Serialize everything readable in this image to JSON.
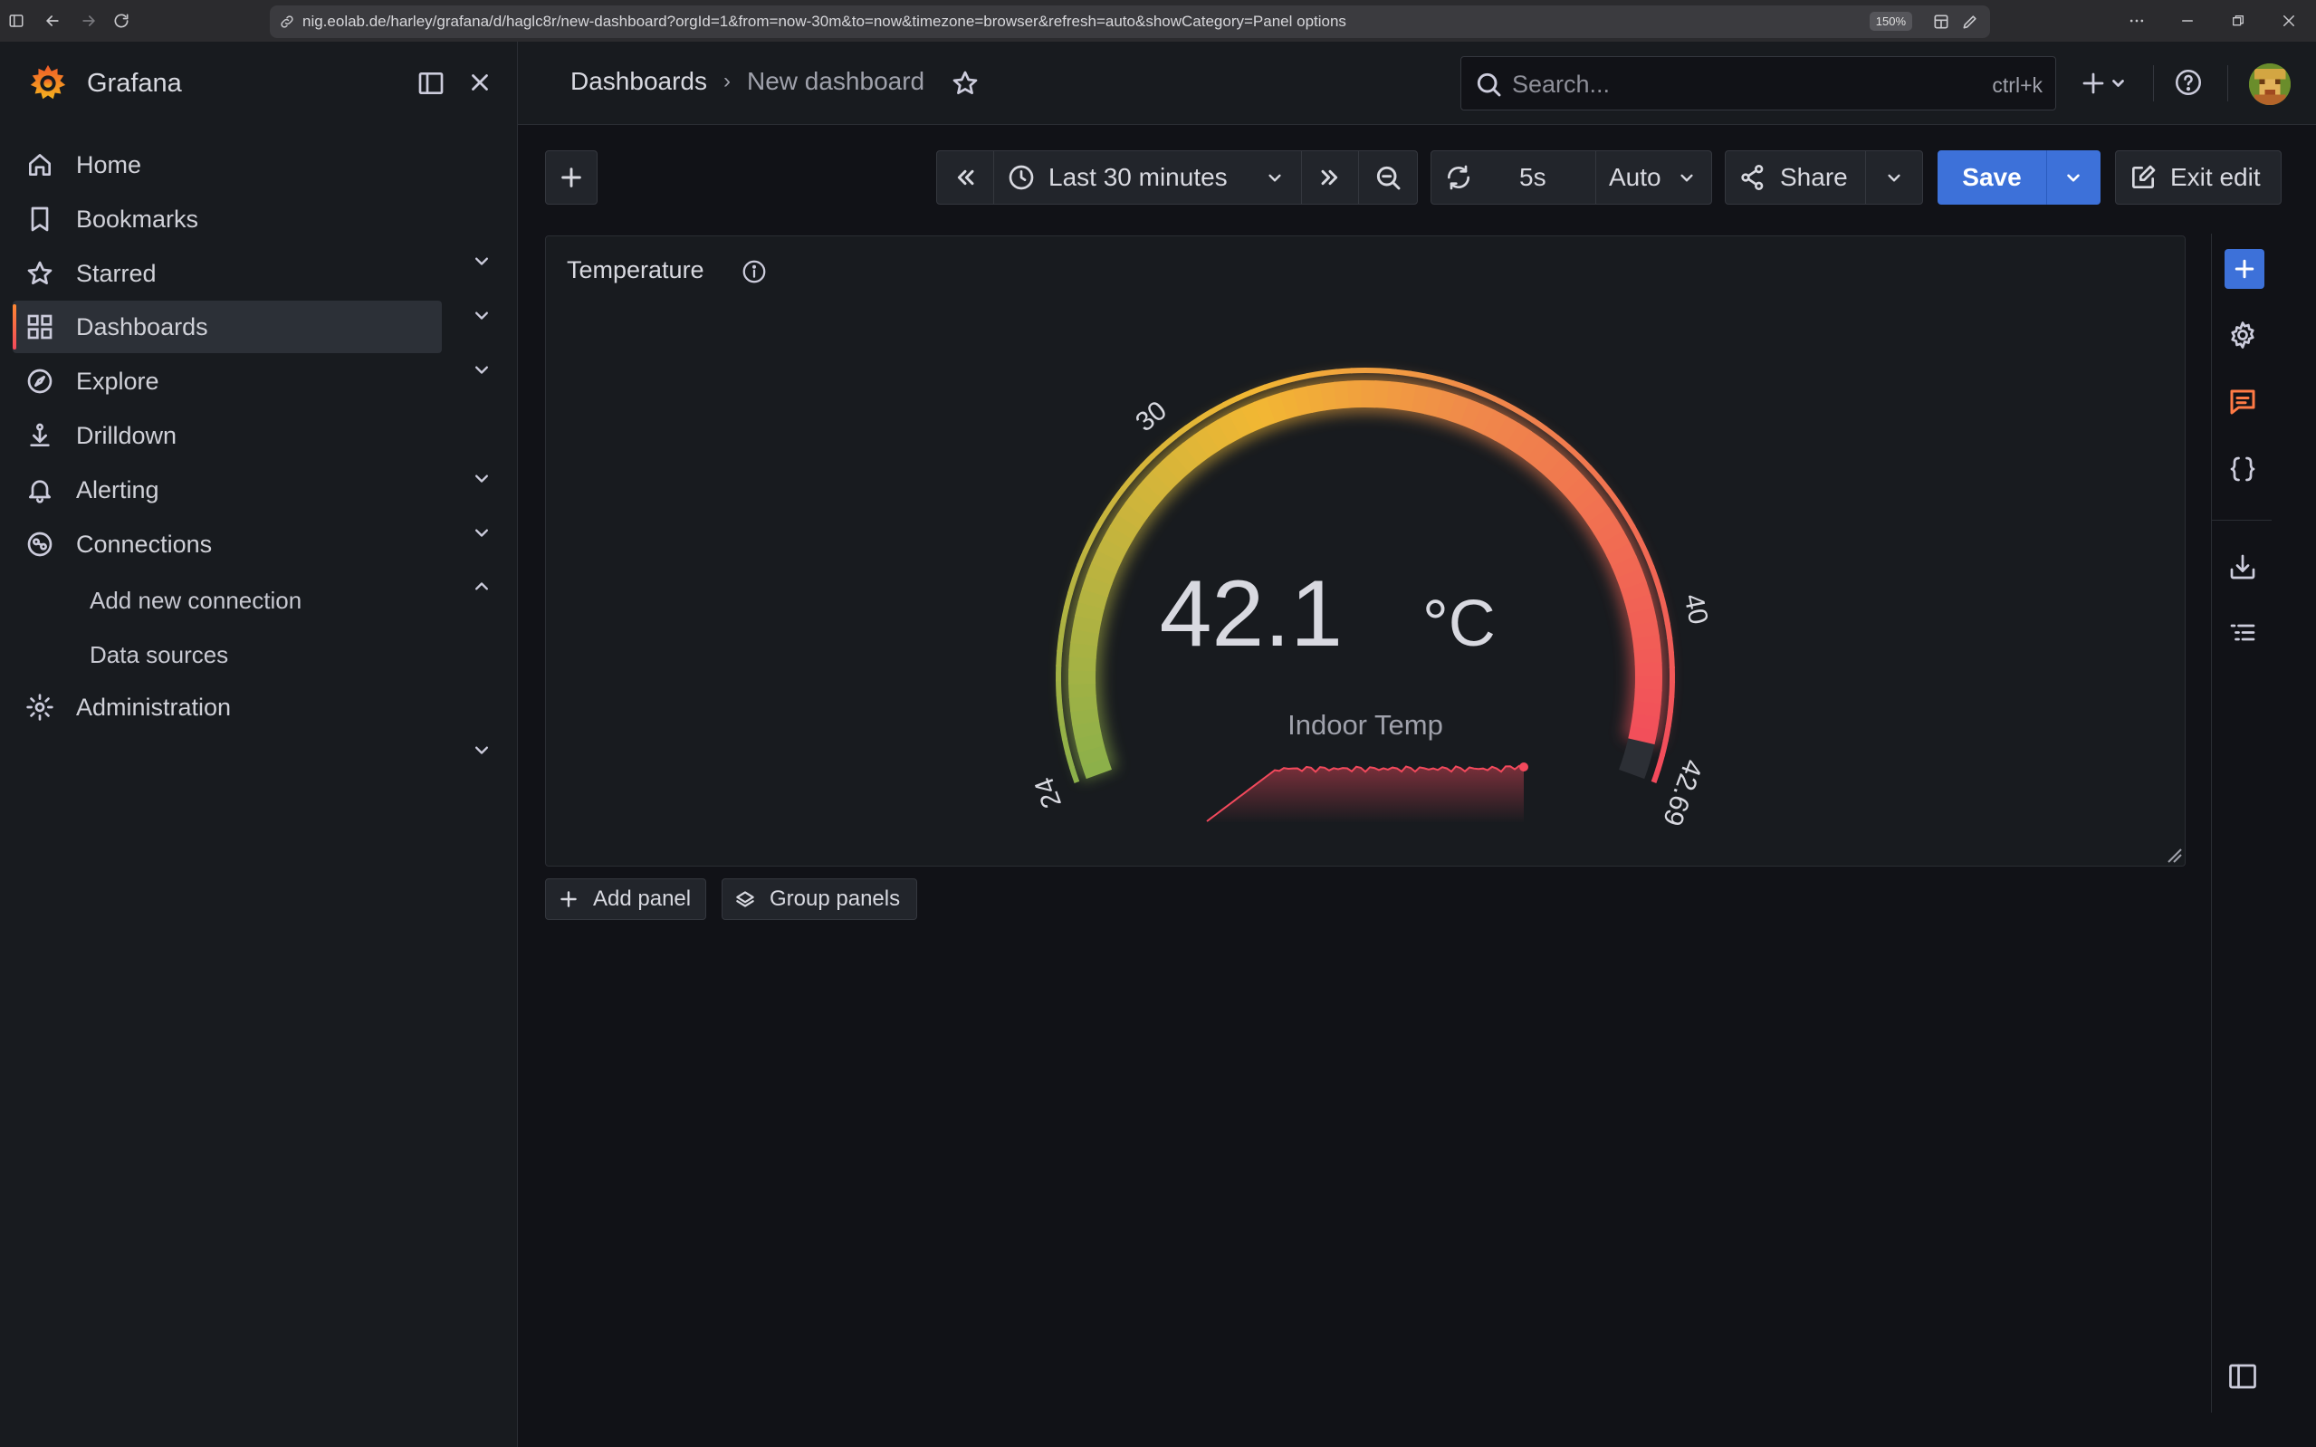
{
  "browser": {
    "url": "nig.eolab.de/harley/grafana/d/haglc8r/new-dashboard?orgId=1&from=now-30m&to=now&timezone=browser&refresh=auto&showCategory=Panel options",
    "zoom": "150%"
  },
  "app": {
    "name": "Grafana"
  },
  "sidebar": {
    "items": [
      {
        "label": "Home",
        "icon": "home-icon"
      },
      {
        "label": "Bookmarks",
        "icon": "bookmark-icon"
      },
      {
        "label": "Starred",
        "icon": "star-icon"
      },
      {
        "label": "Dashboards",
        "icon": "apps-icon",
        "active": true
      },
      {
        "label": "Explore",
        "icon": "compass-icon"
      },
      {
        "label": "Drilldown",
        "icon": "drilldown-icon"
      },
      {
        "label": "Alerting",
        "icon": "bell-icon"
      },
      {
        "label": "Connections",
        "icon": "connections-icon",
        "expanded": true
      },
      {
        "label": "Administration",
        "icon": "gear-icon"
      }
    ],
    "connections_children": [
      "Add new connection",
      "Data sources"
    ]
  },
  "header": {
    "breadcrumb": [
      "Dashboards",
      "New dashboard"
    ],
    "search_placeholder": "Search...",
    "search_shortcut": "ctrl+k"
  },
  "toolbar": {
    "time_range": "Last 30 minutes",
    "refresh_interval": "5s",
    "auto_label": "Auto",
    "share_label": "Share",
    "save_label": "Save",
    "exit_edit_label": "Exit edit"
  },
  "panel": {
    "title": "Temperature",
    "value": "42.1",
    "unit": "°C",
    "name": "Indoor Temp",
    "gauge": {
      "min": 24,
      "max": 42.69,
      "current": 42.1,
      "tick_labels": [
        "24",
        "30",
        "40",
        "42.69"
      ],
      "colors": {
        "low": "#8ab04a",
        "mid": "#f2b733",
        "high": "#f2495c",
        "track": "#2c2f35"
      }
    },
    "sparkline_color": "#f2495c"
  },
  "actions": {
    "add_panel": "Add panel",
    "group_panels": "Group panels"
  },
  "colors": {
    "accent_blue": "#3d71d9",
    "brand_orange": "#ff8833",
    "background": "#111217",
    "surface": "#181b1f"
  }
}
